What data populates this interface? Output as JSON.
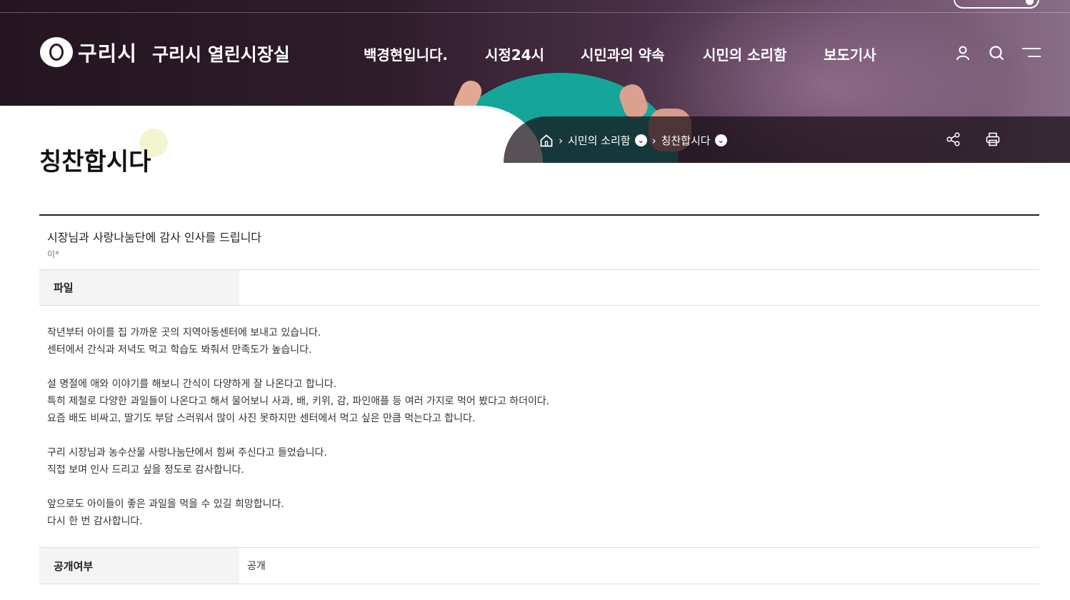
{
  "header": {
    "logo_text": "구리시",
    "site_name": "구리시 열린시장실",
    "nav": [
      {
        "label": "백경현입니다."
      },
      {
        "label": "시정24시"
      },
      {
        "label": "시민과의 약속"
      },
      {
        "label": "시민의 소리함"
      },
      {
        "label": "보도기사"
      }
    ],
    "icons": [
      "user-icon",
      "search-icon",
      "menu-icon"
    ]
  },
  "breadcrumb": {
    "home_icon": "home-icon",
    "items": [
      {
        "label": "시민의 소리함"
      },
      {
        "label": "칭찬합시다"
      }
    ],
    "dropdown_icon": "chevron-down-icon"
  },
  "tools": {
    "share_icon": "share-icon",
    "print_icon": "print-icon"
  },
  "page_title": "칭찬합시다",
  "post": {
    "subject": "시장님과 사랑나눔단에 감사 인사를 드립니다",
    "writer": "이*",
    "file_label": "파일",
    "file_value": "",
    "body_lines": [
      "작년부터 아이를 집 가까운 곳의 지역아동센터에 보내고 있습니다.",
      "센터에서 간식과 저녁도 먹고 학습도 봐줘서 만족도가 높습니다.",
      "",
      "설 명절에 애와 이야기를 해보니 간식이 다양하게 잘 나온다고 합니다.",
      "특히 제철로 다양한 과일들이 나온다고 해서 물어보니 사과, 배, 키위, 감, 파인애플 등 여러 가지로 먹어 봤다고 하더이다.",
      "요즘 배도 비싸고, 딸기도 부담 스러워서 많이 사진 못하지만 센터에서 먹고 싶은 만큼 먹는다고 합니다.",
      "",
      "구리 시장님과 농수산물 사랑나눔단에서 힘써 주신다고 들었습니다.",
      "직접 보며 인사 드리고 싶을 정도로 감사합니다.",
      "",
      "앞으로도 아이들이 좋은 과일을 먹을 수 있길 희망합니다.",
      "다시 한 번 감사합니다."
    ],
    "open_label": "공개여부",
    "open_value": "공개"
  }
}
